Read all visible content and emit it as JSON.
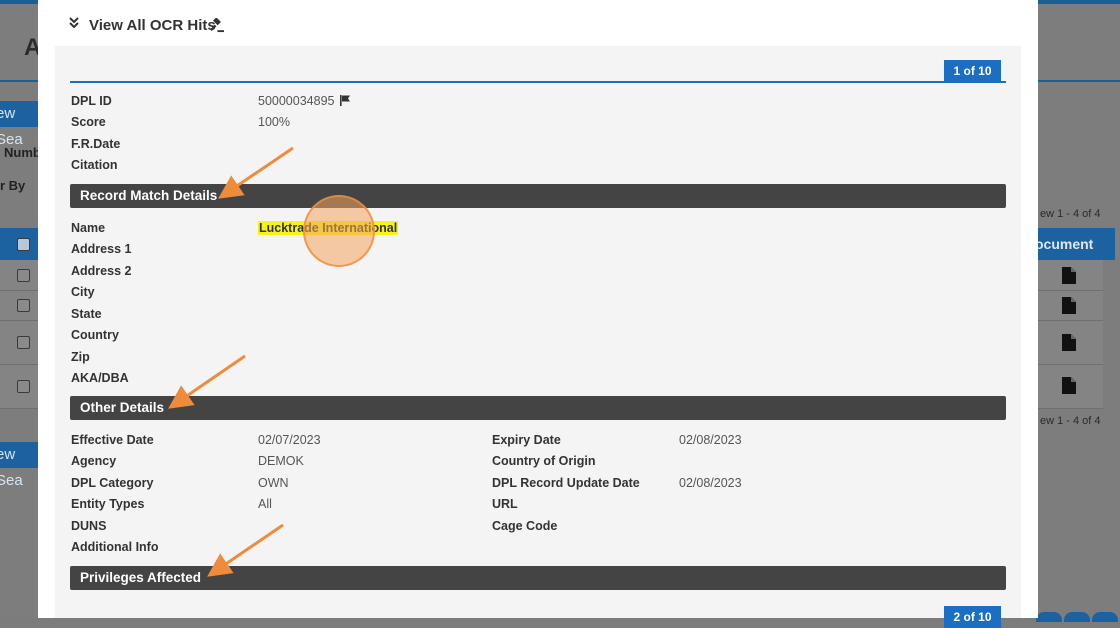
{
  "background": {
    "title_fragment": "A",
    "button1_fragment": "ew Sea",
    "button2_fragment": "ew Sea",
    "label1": "Numb",
    "label2": "r By",
    "doc_header_fragment": "ocument",
    "view_text1": "ew 1 - 4 of 4",
    "view_text2": "ew 1 - 4 of 4"
  },
  "modal": {
    "title": "View All OCR Hits",
    "collapse_icon": "double-chevron-down-icon",
    "title_icon": "gavel-icon",
    "pager_current": "1 of 10",
    "pager_next": "2 of 10"
  },
  "summary": {
    "fields": [
      {
        "label": "DPL ID",
        "value": "50000034895"
      },
      {
        "label": "Score",
        "value": "100%"
      },
      {
        "label": "F.R.Date",
        "value": ""
      },
      {
        "label": "Citation",
        "value": ""
      }
    ],
    "dpl_id_icon": "flag-icon"
  },
  "record_match": {
    "heading": "Record Match Details",
    "fields": [
      {
        "label": "Name",
        "value": "Lucktrade International"
      },
      {
        "label": "Address 1",
        "value": ""
      },
      {
        "label": "Address 2",
        "value": ""
      },
      {
        "label": "City",
        "value": ""
      },
      {
        "label": "State",
        "value": ""
      },
      {
        "label": "Country",
        "value": ""
      },
      {
        "label": "Zip",
        "value": ""
      },
      {
        "label": "AKA/DBA",
        "value": ""
      }
    ]
  },
  "other_details": {
    "heading": "Other Details",
    "left": [
      {
        "label": "Effective Date",
        "value": "02/07/2023"
      },
      {
        "label": "Agency",
        "value": "DEMOK"
      },
      {
        "label": "DPL Category",
        "value": "OWN"
      },
      {
        "label": "Entity Types",
        "value": "All"
      },
      {
        "label": "DUNS",
        "value": ""
      },
      {
        "label": "Additional Info",
        "value": ""
      }
    ],
    "right": [
      {
        "label": "Expiry Date",
        "value": "02/08/2023"
      },
      {
        "label": "Country of Origin",
        "value": ""
      },
      {
        "label": "DPL Record Update Date",
        "value": "02/08/2023"
      },
      {
        "label": "URL",
        "value": ""
      },
      {
        "label": "Cage Code",
        "value": ""
      }
    ]
  },
  "privileges": {
    "heading": "Privileges Affected"
  },
  "colors": {
    "section_bg": "#444444",
    "accent_blue": "#1b6ec2",
    "highlight": "#f7f21a",
    "annotation_arrow": "#ef8c3c"
  }
}
